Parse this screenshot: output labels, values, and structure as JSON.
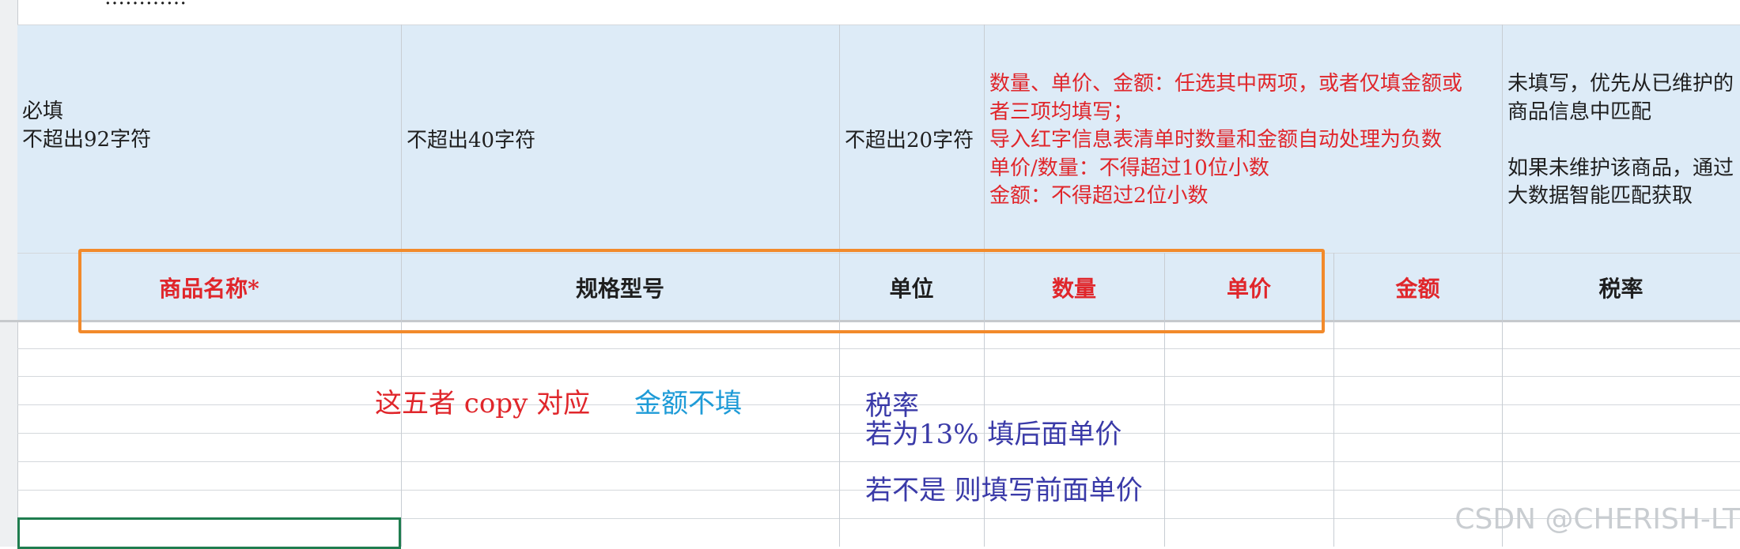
{
  "top_row_partial": "…………",
  "notes": {
    "product_name": "必填\n不超出92字符",
    "spec_model": "不超出40字符",
    "unit": "不超出20字符",
    "qty_price_amount": "数量、单价、金额：任选其中两项，或者仅填金额或\n者三项均填写；\n导入红字信息表清单时数量和金额自动处理为负数\n单价/数量：不得超过10位小数\n金额：不得超过2位小数",
    "tax_rate": "未填写，优先从已维护的\n商品信息中匹配\n\n如果未维护该商品，通过\n大数据智能匹配获取"
  },
  "headers": {
    "product_name": "商品名称*",
    "spec_model": "规格型号",
    "unit": "单位",
    "quantity": "数量",
    "unit_price": "单价",
    "amount": "金额",
    "tax_rate": "税率"
  },
  "annotations": {
    "copy_prefix": "这五者 copy 对应",
    "amount_blank": "金额不填",
    "tax_line1": "税率",
    "tax_line2": "若为13% 填后面单价",
    "tax_line3": "若不是  则填写前面单价"
  },
  "colors": {
    "note_blue_bg": "#ddebf7",
    "required_red": "#e0262b",
    "annotation_red": "#e0262b",
    "annotation_cyan": "#1e9bd7",
    "annotation_blue": "#3a3aa8",
    "highlight_orange": "#f28a2b",
    "selection_green": "#1f7d4f"
  },
  "watermark": "CSDN @CHERISH-LT"
}
